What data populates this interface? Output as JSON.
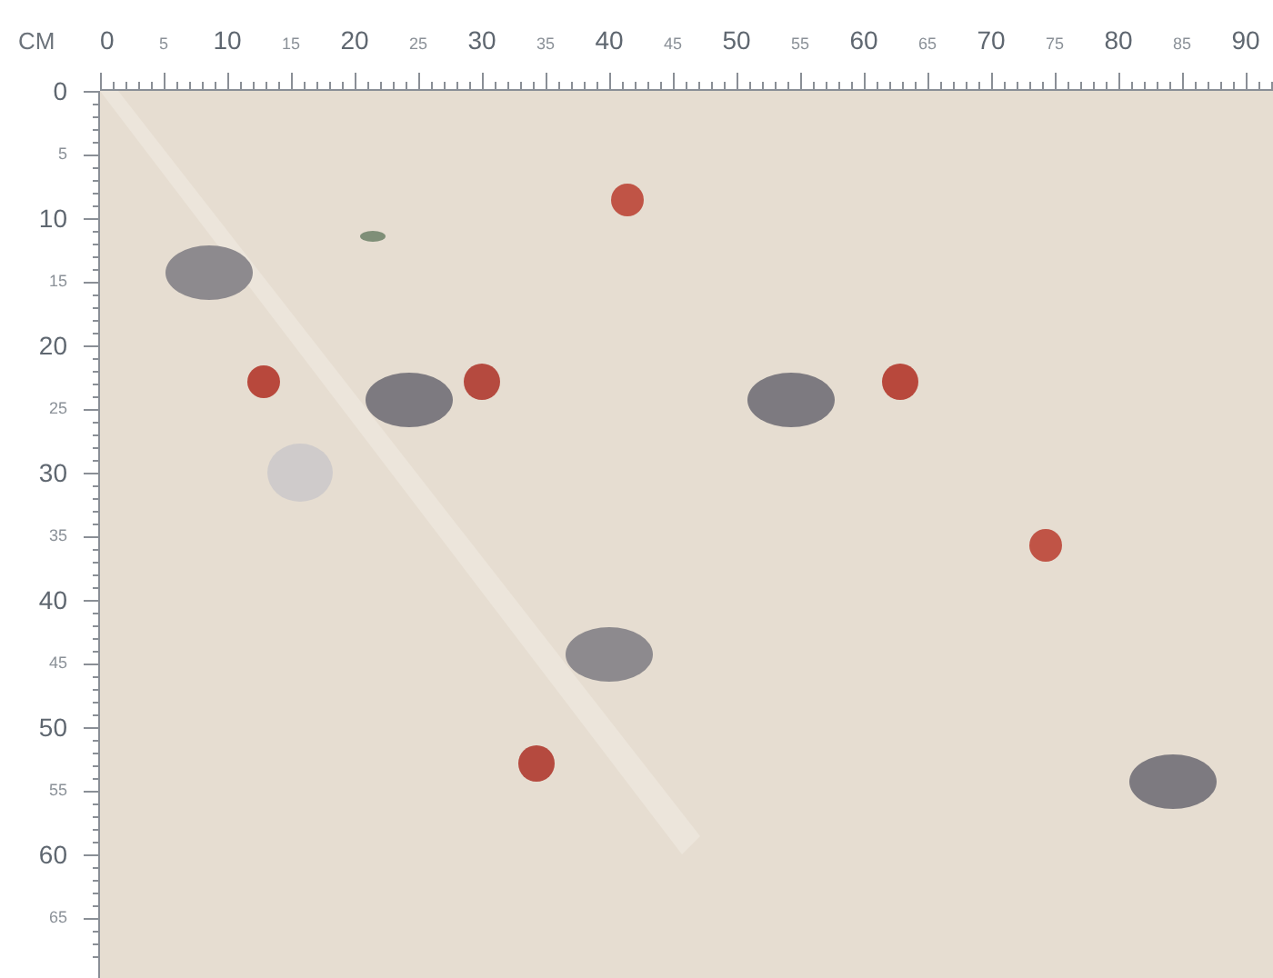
{
  "unit": "CM",
  "top_ruler": {
    "labels": [
      {
        "text": "0",
        "kind": "major"
      },
      {
        "text": "5",
        "kind": "minor"
      },
      {
        "text": "10",
        "kind": "major"
      },
      {
        "text": "15",
        "kind": "minor"
      },
      {
        "text": "20",
        "kind": "major"
      },
      {
        "text": "25",
        "kind": "minor"
      },
      {
        "text": "30",
        "kind": "major"
      },
      {
        "text": "35",
        "kind": "minor"
      },
      {
        "text": "40",
        "kind": "major"
      },
      {
        "text": "45",
        "kind": "minor"
      },
      {
        "text": "50",
        "kind": "major"
      },
      {
        "text": "55",
        "kind": "minor"
      },
      {
        "text": "60",
        "kind": "major"
      },
      {
        "text": "65",
        "kind": "minor"
      },
      {
        "text": "70",
        "kind": "major"
      },
      {
        "text": "75",
        "kind": "minor"
      },
      {
        "text": "80",
        "kind": "major"
      },
      {
        "text": "85",
        "kind": "minor"
      },
      {
        "text": "90",
        "kind": "major"
      }
    ]
  },
  "left_ruler": {
    "labels": [
      {
        "text": "0",
        "kind": "major"
      },
      {
        "text": "5",
        "kind": "minor"
      },
      {
        "text": "10",
        "kind": "major"
      },
      {
        "text": "15",
        "kind": "minor"
      },
      {
        "text": "20",
        "kind": "major"
      },
      {
        "text": "25",
        "kind": "minor"
      },
      {
        "text": "30",
        "kind": "major"
      },
      {
        "text": "35",
        "kind": "minor"
      },
      {
        "text": "40",
        "kind": "major"
      },
      {
        "text": "45",
        "kind": "minor"
      },
      {
        "text": "50",
        "kind": "major"
      },
      {
        "text": "55",
        "kind": "minor"
      },
      {
        "text": "60",
        "kind": "major"
      },
      {
        "text": "65",
        "kind": "minor"
      }
    ]
  }
}
